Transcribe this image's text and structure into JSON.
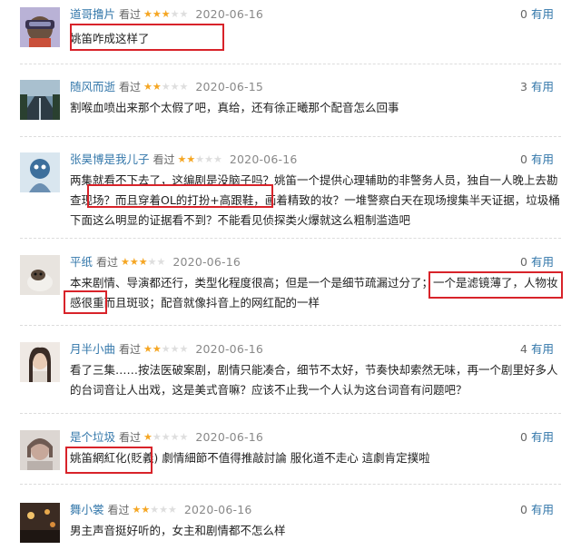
{
  "reviews": [
    {
      "user": "道哥撸片",
      "seen": "看过",
      "stars": 3,
      "date": "2020-06-16",
      "useful_count": "0",
      "useful_label": "有用",
      "content": "姚笛咋成这样了"
    },
    {
      "user": "随风而逝",
      "seen": "看过",
      "stars": 2,
      "date": "2020-06-15",
      "useful_count": "3",
      "useful_label": "有用",
      "content": "割喉血喷出来那个太假了吧，真给，还有徐正曦那个配音怎么回事"
    },
    {
      "user": "张昊博是我儿子",
      "seen": "看过",
      "stars": 2,
      "date": "2020-06-16",
      "useful_count": "0",
      "useful_label": "有用",
      "content": "两集就看不下去了，这编剧是没脑子吗？姚笛一个提供心理辅助的非警务人员，独自一人晚上去勘查现场？而且穿着OL的打扮+高跟鞋，画着精致的妆？一堆警察白天在现场搜集半天证据，垃圾桶下面这么明显的证据看不到？不能看见侦探类火爆就这么粗制滥造吧"
    },
    {
      "user": "平纸",
      "seen": "看过",
      "stars": 3,
      "date": "2020-06-16",
      "useful_count": "0",
      "useful_label": "有用",
      "content": "本来剧情、导演都还行，类型化程度很高；但是一个是细节疏漏过分了；一个是滤镜薄了，人物妆感很重而且斑驳；配音就像抖音上的网红配的一样"
    },
    {
      "user": "月半小曲",
      "seen": "看过",
      "stars": 2,
      "date": "2020-06-16",
      "useful_count": "4",
      "useful_label": "有用",
      "content": "看了三集……按法医破案剧，剧情只能凑合，细节不太好，节奏快却索然无味，再一个剧里好多人的台词音让人出戏，这是美式音嘛？应该不止我一个人认为这台词音有问题吧？"
    },
    {
      "user": "是个垃圾",
      "seen": "看过",
      "stars": 1,
      "date": "2020-06-16",
      "useful_count": "0",
      "useful_label": "有用",
      "content": "姚笛網紅化(貶義) 劇情細節不值得推敲討論 服化道不走心 這劇肯定撲啦"
    },
    {
      "user": "舞小裳",
      "seen": "看过",
      "stars": 2,
      "date": "2020-06-16",
      "useful_count": "0",
      "useful_label": "有用",
      "content": "男主声音挺好听的，女主和剧情都不怎么样"
    }
  ]
}
